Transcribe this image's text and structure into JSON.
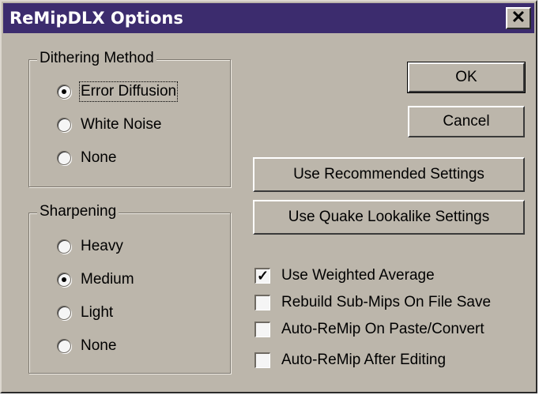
{
  "window": {
    "title": "ReMipDLX Options",
    "close_glyph": "✕"
  },
  "dithering": {
    "legend": "Dithering Method",
    "options": [
      {
        "label": "Error Diffusion",
        "selected": true
      },
      {
        "label": "White Noise",
        "selected": false
      },
      {
        "label": "None",
        "selected": false
      }
    ]
  },
  "sharpening": {
    "legend": "Sharpening",
    "options": [
      {
        "label": "Heavy",
        "selected": false
      },
      {
        "label": "Medium",
        "selected": true
      },
      {
        "label": "Light",
        "selected": false
      },
      {
        "label": "None",
        "selected": false
      }
    ]
  },
  "buttons": {
    "ok": "OK",
    "cancel": "Cancel",
    "recommended": "Use Recommended Settings",
    "quake": "Use Quake Lookalike Settings"
  },
  "options": [
    {
      "label": "Use Weighted Average",
      "checked": true
    },
    {
      "label": "Rebuild Sub-Mips On File Save",
      "checked": false
    },
    {
      "label": "Auto-ReMip On Paste/Convert",
      "checked": false
    },
    {
      "label": "Auto-ReMip After Editing",
      "checked": false
    }
  ],
  "colors": {
    "titlebar": "#3c2c6e",
    "face": "#bcb6ab"
  }
}
